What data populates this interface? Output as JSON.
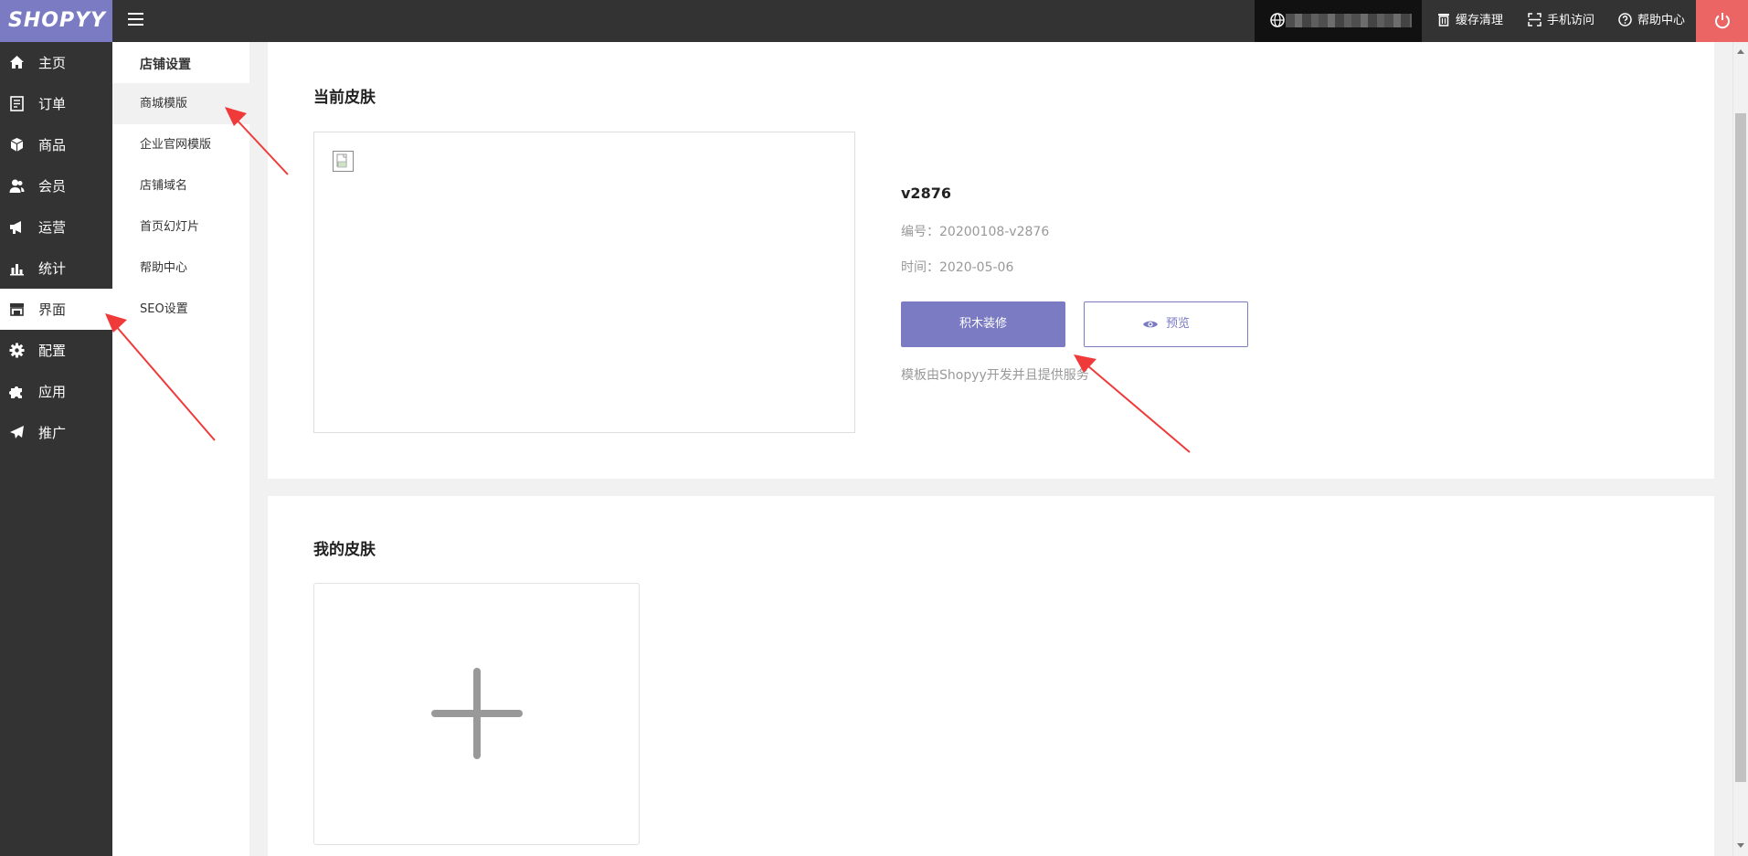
{
  "topbar": {
    "logo": "SHOPYY",
    "links": [
      {
        "label": "缓存清理",
        "icon": "trash-icon"
      },
      {
        "label": "手机访问",
        "icon": "scan-icon"
      },
      {
        "label": "帮助中心",
        "icon": "help-icon"
      }
    ]
  },
  "leftnav": {
    "items": [
      {
        "label": "主页",
        "icon": "home-icon"
      },
      {
        "label": "订单",
        "icon": "order-icon"
      },
      {
        "label": "商品",
        "icon": "box-icon"
      },
      {
        "label": "会员",
        "icon": "users-icon"
      },
      {
        "label": "运营",
        "icon": "megaphone-icon"
      },
      {
        "label": "统计",
        "icon": "chart-icon"
      },
      {
        "label": "界面",
        "icon": "store-icon"
      },
      {
        "label": "配置",
        "icon": "gear-icon"
      },
      {
        "label": "应用",
        "icon": "puzzle-icon"
      },
      {
        "label": "推广",
        "icon": "paper-plane-icon"
      }
    ]
  },
  "subnav": {
    "title": "店铺设置",
    "items": [
      "商城模版",
      "企业官网模版",
      "店铺域名",
      "首页幻灯片",
      "帮助中心",
      "SEO设置"
    ]
  },
  "current_skin": {
    "section_title": "当前皮肤",
    "name": "v2876",
    "code": "编号：20200108-v2876",
    "time": "时间：2020-05-06",
    "decorate_button": "积木装修",
    "preview_button": "预览",
    "note": "模板由Shopyy开发并且提供服务"
  },
  "my_skins": {
    "section_title": "我的皮肤"
  },
  "colors": {
    "accent": "#7b7bc4",
    "sidebar": "#333333",
    "power": "#ec6565",
    "annotation_arrow": "#f03a3a"
  }
}
